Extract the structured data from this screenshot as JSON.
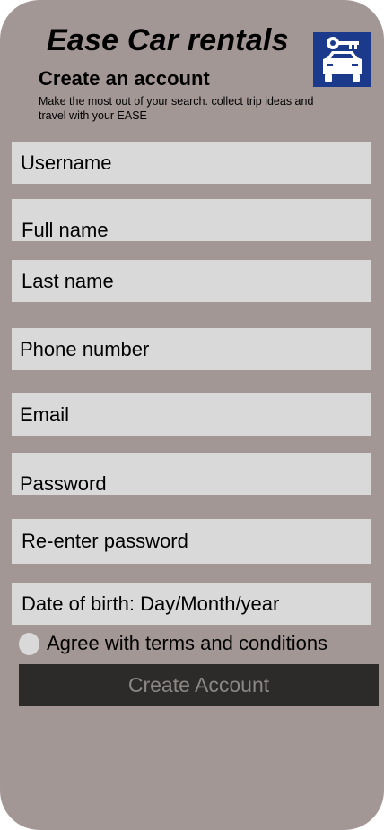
{
  "header": {
    "app_title": "Ease Car rentals",
    "logo_icon": "car-key-logo-icon",
    "logo_color": "#1c3a8c",
    "heading": "Create an account",
    "subtitle": "Make the most out of your search. collect trip ideas and travel with your EASE"
  },
  "form": {
    "username": "Username",
    "full_name": "Full name",
    "last_name": "Last name",
    "phone": "Phone number",
    "email": "Email",
    "password": "Password",
    "reenter_password": "Re-enter password",
    "dob": "Date of birth: Day/Month/year",
    "agree_label": "Agree with terms and conditions",
    "agree_checked": false,
    "submit_label": "Create Account"
  },
  "colors": {
    "background": "#a39796",
    "field": "#d9d9d9",
    "button": "#2d2b29",
    "button_text": "#8a8785"
  }
}
